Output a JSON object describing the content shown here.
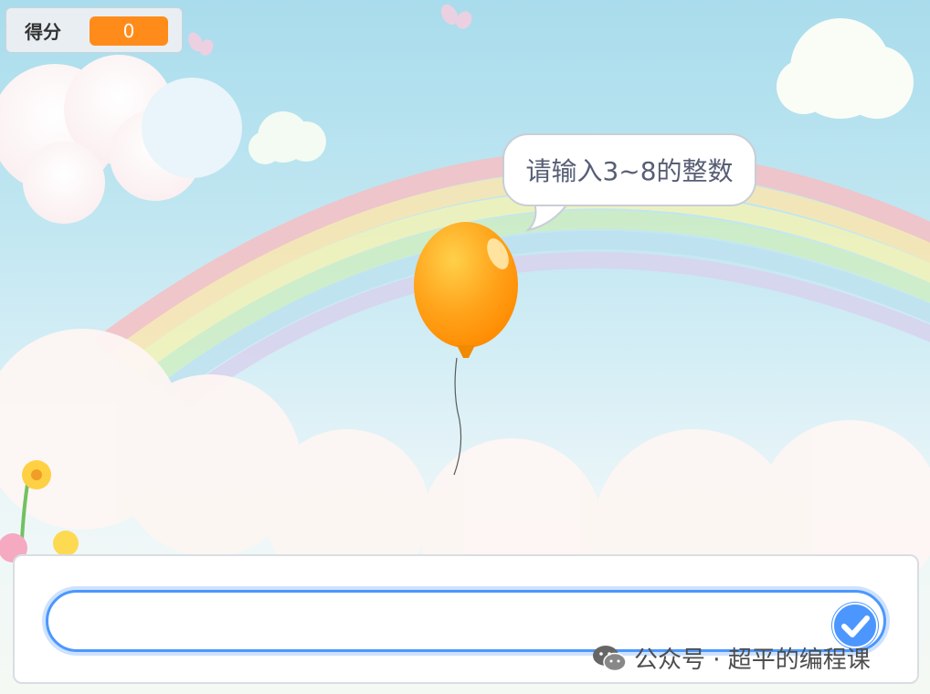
{
  "score": {
    "label": "得分",
    "value": "0",
    "value_color": "#ff8c1a"
  },
  "speech_bubble": {
    "text": "请输入3~8的整数"
  },
  "ask_prompt": {
    "input_value": "",
    "submit_icon": "check-icon",
    "accent_color": "#4c97ff"
  },
  "sprite": {
    "name": "balloon",
    "color": "#ff9f12"
  },
  "watermark": {
    "icon": "wechat-icon",
    "text": "公众号 · 超平的编程课"
  }
}
